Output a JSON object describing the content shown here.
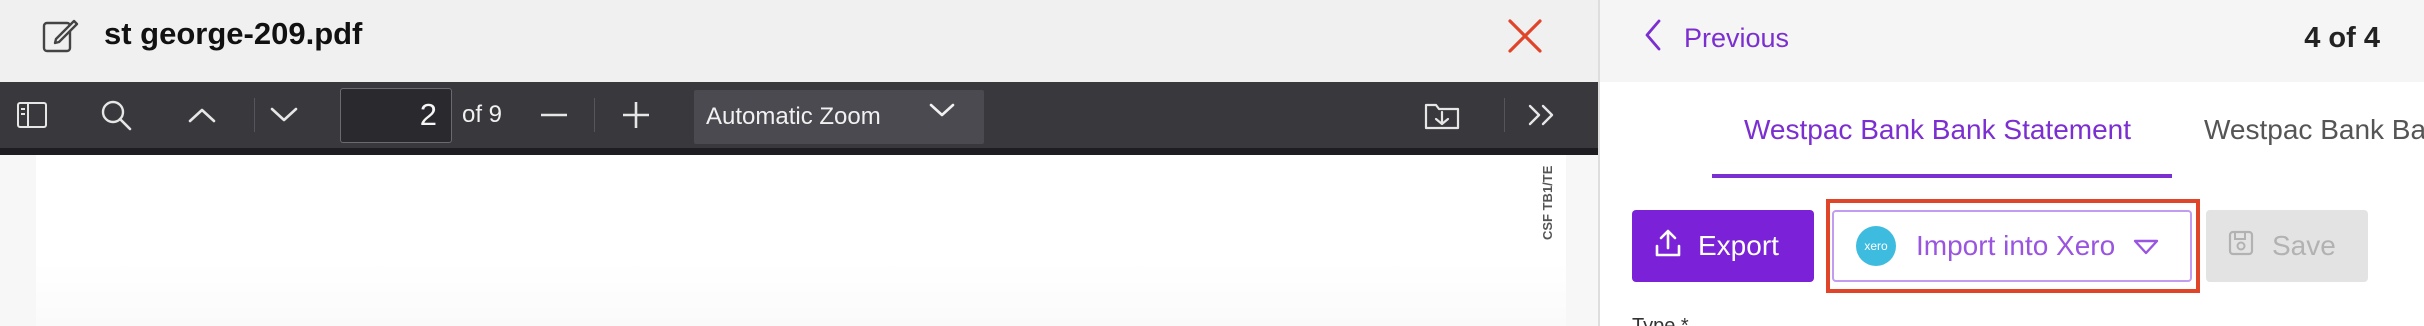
{
  "viewer": {
    "file_title": "st george-209.pdf",
    "toolbar": {
      "page_number": "2",
      "page_total_text": "of 9",
      "zoom_label": "Automatic Zoom"
    },
    "side_code": "CSF TB1/TE"
  },
  "panel": {
    "previous_label": "Previous",
    "counter": "4 of 4",
    "tabs": [
      {
        "label": "Westpac Bank Bank Statement",
        "active": true
      },
      {
        "label": "Westpac Bank Ba",
        "active": false
      }
    ],
    "actions": {
      "export_label": "Export",
      "import_label": "Import into Xero",
      "xero_logo_text": "xero",
      "save_label": "Save"
    },
    "type_label": "Type *"
  },
  "colors": {
    "accent": "#7b22d8",
    "highlight": "#e0452a",
    "close": "#e0452a",
    "xero": "#3dbce0",
    "toolbar": "#38383d"
  },
  "icons": [
    "edit-icon",
    "close-icon",
    "sidebar-toggle-icon",
    "search-icon",
    "chevron-up-icon",
    "chevron-down-icon",
    "zoom-out-icon",
    "zoom-in-icon",
    "download-icon",
    "tools-menu-icon",
    "chevron-left-icon",
    "upload-icon",
    "xero-logo",
    "caret-down-icon",
    "save-icon"
  ]
}
